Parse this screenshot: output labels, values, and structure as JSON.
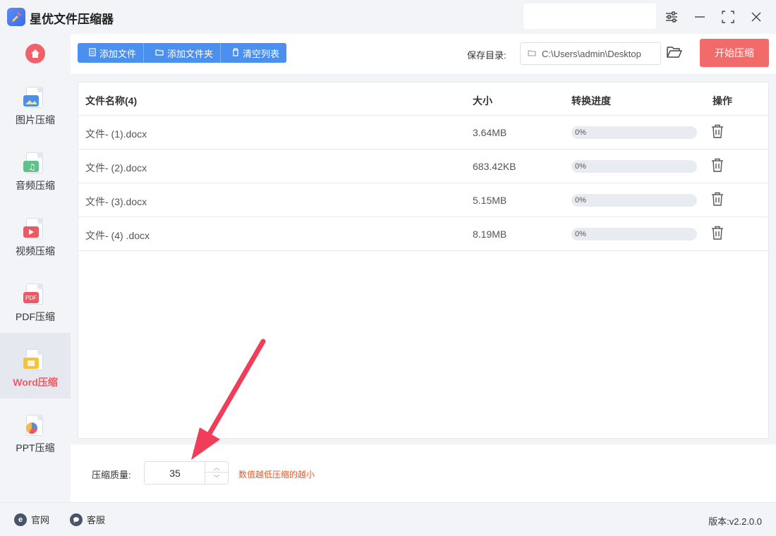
{
  "app": {
    "title": "星优文件压缩器"
  },
  "sidebar": {
    "items": [
      {
        "label": "图片压缩",
        "icon": "image-icon"
      },
      {
        "label": "音频压缩",
        "icon": "audio-icon"
      },
      {
        "label": "视频压缩",
        "icon": "video-icon"
      },
      {
        "label": "PDF压缩",
        "icon": "pdf-icon"
      },
      {
        "label": "Word压缩",
        "icon": "word-icon",
        "active": true
      },
      {
        "label": "PPT压缩",
        "icon": "ppt-icon"
      }
    ],
    "pdf_badge": "PDF"
  },
  "toolbar": {
    "add_file": "添加文件",
    "add_folder": "添加文件夹",
    "clear_list": "清空列表",
    "save_label": "保存目录:",
    "save_path": "C:\\Users\\admin\\Desktop",
    "start": "开始压缩"
  },
  "table": {
    "headers": {
      "name": "文件名称(4)",
      "size": "大小",
      "progress": "转换进度",
      "action": "操作"
    },
    "rows": [
      {
        "name": "文件- (1).docx",
        "size": "3.64MB",
        "progress": "0%",
        "progress_value": 0
      },
      {
        "name": "文件- (2).docx",
        "size": "683.42KB",
        "progress": "0%",
        "progress_value": 0
      },
      {
        "name": "文件- (3).docx",
        "size": "5.15MB",
        "progress": "0%",
        "progress_value": 0
      },
      {
        "name": "文件- (4) .docx",
        "size": "8.19MB",
        "progress": "0%",
        "progress_value": 0
      }
    ]
  },
  "settings": {
    "quality_label": "压缩质量:",
    "quality_value": "35",
    "hint": "数值越低压缩的越小"
  },
  "footer": {
    "website": "官网",
    "website_icon": "e",
    "support": "客服",
    "version": "版本:v2.2.0.0"
  },
  "colors": {
    "accent": "#4b90ee",
    "start": "#f26b6b",
    "active_text": "#f05a63",
    "hint": "#e8592a"
  }
}
